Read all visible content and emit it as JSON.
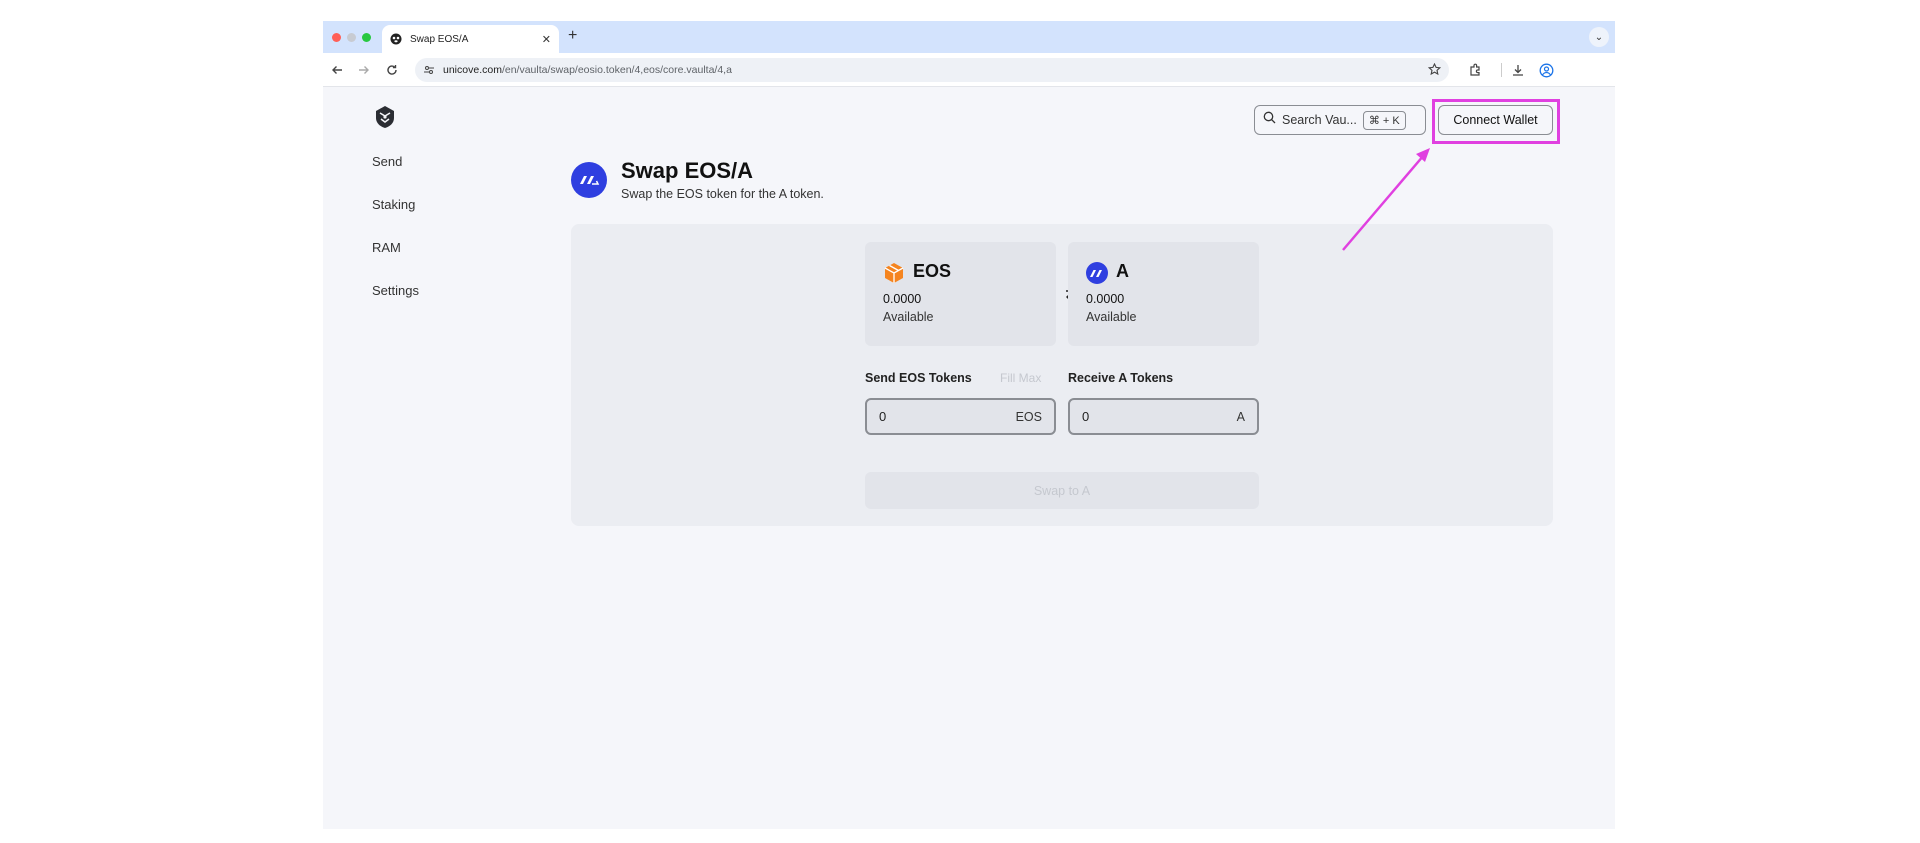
{
  "browser": {
    "tab_title": "Swap EOS/A",
    "url_host": "unicove.com",
    "url_path": "/en/vaulta/swap/eosio.token/4,eos/core.vaulta/4,a"
  },
  "sidebar": {
    "items": [
      {
        "label": "Send"
      },
      {
        "label": "Staking"
      },
      {
        "label": "RAM"
      },
      {
        "label": "Settings"
      }
    ]
  },
  "header": {
    "search_label": "Search Vau...",
    "search_shortcut": "⌘ + K",
    "connect_label": "Connect Wallet"
  },
  "main": {
    "title": "Swap EOS/A",
    "subtitle": "Swap the EOS token for the A token.",
    "from_token": {
      "symbol": "EOS",
      "balance": "0.0000",
      "available_label": "Available"
    },
    "to_token": {
      "symbol": "A",
      "balance": "0.0000",
      "available_label": "Available"
    },
    "send_label": "Send EOS Tokens",
    "fill_max_label": "Fill Max",
    "receive_label": "Receive A Tokens",
    "send_amount": "0",
    "send_unit": "EOS",
    "receive_amount": "0",
    "receive_unit": "A",
    "submit_label": "Swap to A"
  },
  "colors": {
    "highlight": "#e040e0",
    "brand_blue": "#2f3fe0",
    "eos_orange": "#f5841f"
  },
  "icons": [
    "traffic-lights",
    "panda-favicon",
    "back-arrow-icon",
    "forward-arrow-icon",
    "reload-icon",
    "site-settings-icon",
    "star-icon",
    "extensions-icon",
    "download-icon",
    "profile-icon",
    "search-icon",
    "swap-direction-icon"
  ]
}
